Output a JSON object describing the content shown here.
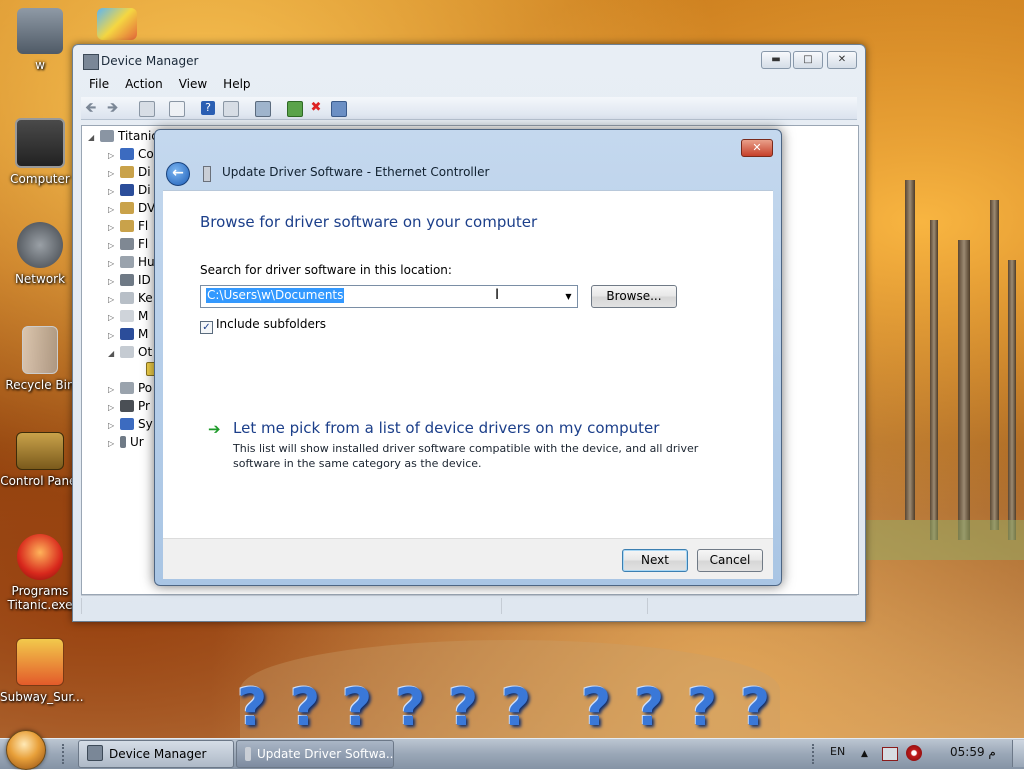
{
  "desktop": {
    "icons": [
      {
        "label": "w"
      },
      {
        "label": "Computer"
      },
      {
        "label": "Network"
      },
      {
        "label": "Recycle Bin"
      },
      {
        "label": "Control Panel"
      },
      {
        "label": "Programs Titanic.exe"
      },
      {
        "label": "Subway_Sur..."
      }
    ],
    "dock_glyph": "?"
  },
  "device_manager": {
    "title": "Device Manager",
    "menu": [
      "File",
      "Action",
      "View",
      "Help"
    ],
    "tree_root": "Titanic",
    "tree_items": [
      "Co",
      "Di",
      "Di",
      "DV",
      "Fl",
      "Fl",
      "Hu",
      "ID",
      "Ke",
      "M",
      "M",
      "Ot",
      "Po",
      "Pr",
      "Sy",
      "Ur"
    ]
  },
  "wizard": {
    "title": "Update Driver Software - Ethernet Controller",
    "heading": "Browse for driver software on your computer",
    "search_label": "Search for driver software in this location:",
    "path_value": "C:\\Users\\w\\Documents",
    "browse_label": "Browse...",
    "include_subfolders_label": "Include subfolders",
    "include_subfolders_checked": true,
    "pick_title": "Let me pick from a list of device drivers on my computer",
    "pick_desc": "This list will show installed driver software compatible with the device, and all driver software in the same category as the device.",
    "next_label": "Next",
    "cancel_label": "Cancel"
  },
  "taskbar": {
    "tasks": [
      "Device Manager",
      "Update Driver Softwa..."
    ],
    "language": "EN",
    "clock": "05:59 م"
  },
  "colors": {
    "accent_blue": "#1c3f8a",
    "selection": "#3399ff",
    "close_red": "#c6402a"
  }
}
